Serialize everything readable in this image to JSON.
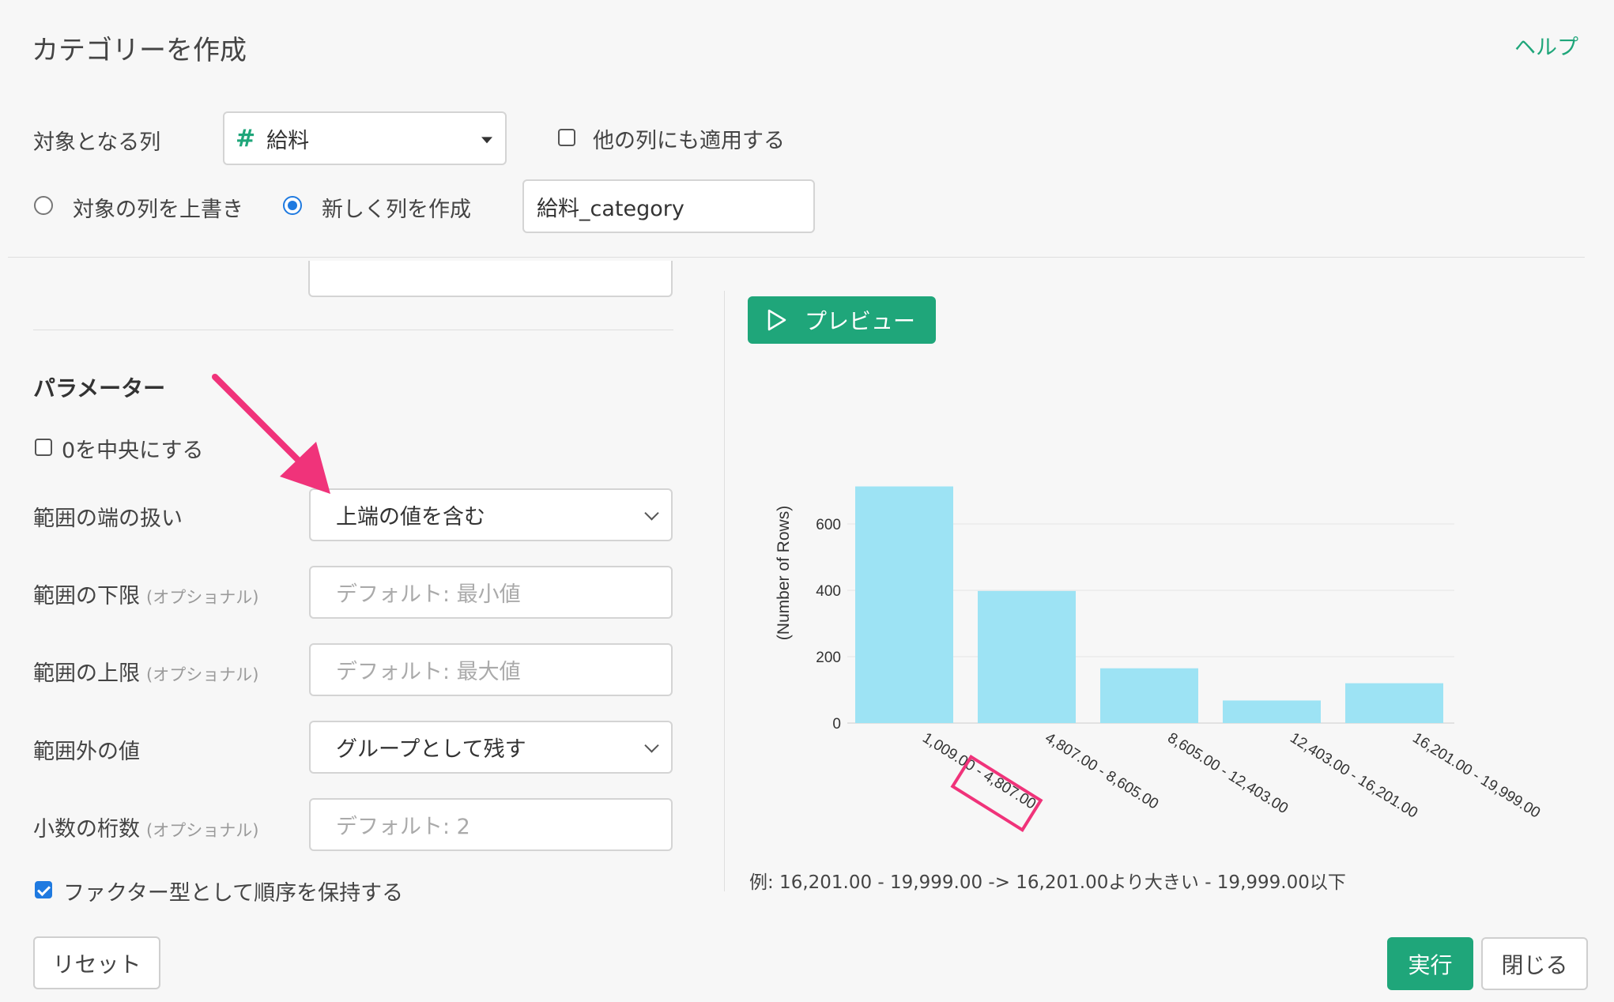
{
  "dialog": {
    "title": "カテゴリーを作成",
    "help": "ヘルプ"
  },
  "target": {
    "label": "対象となる列",
    "column_icon": "#",
    "column_value": "給料",
    "apply_other_label": "他の列にも適用する",
    "apply_other_checked": false,
    "overwrite_label": "対象の列を上書き",
    "new_column_label": "新しく列を作成",
    "new_column_selected": true,
    "new_column_name": "給料_category"
  },
  "params": {
    "heading": "パラメーター",
    "center_zero_label": "0を中央にする",
    "center_zero_checked": false,
    "range_edge_label": "範囲の端の扱い",
    "range_edge_value": "上端の値を含む",
    "lower_label": "範囲の下限",
    "lower_optional": "(オプショナル)",
    "lower_placeholder": "デフォルト: 最小値",
    "upper_label": "範囲の上限",
    "upper_optional": "(オプショナル)",
    "upper_placeholder": "デフォルト: 最大値",
    "outside_label": "範囲外の値",
    "outside_value": "グループとして残す",
    "decimals_label": "小数の桁数",
    "decimals_optional": "(オプショナル)",
    "decimals_placeholder": "デフォルト: 2",
    "factor_label": "ファクター型として順序を保持する",
    "factor_checked": true
  },
  "preview_button": "プレビュー",
  "example_text": "例: 16,201.00 - 19,999.00 -> 16,201.00より大きい - 19,999.00以下",
  "buttons": {
    "reset": "リセット",
    "run": "実行",
    "close": "閉じる"
  },
  "colors": {
    "accent_green": "#1fa67a",
    "bar": "#9de3f4",
    "annotation_pink": "#f0337a",
    "checkbox_blue": "#1f7ae0"
  },
  "chart_data": {
    "type": "bar",
    "categories": [
      "1,009.00 - 4,807.00",
      "4,807.00 - 8,605.00",
      "8,605.00 - 12,403.00",
      "12,403.00 - 16,201.00",
      "16,201.00 - 19,999.00"
    ],
    "values": [
      713,
      398,
      165,
      68,
      120
    ],
    "ylabel": "(Number of Rows)",
    "xlabel": "",
    "ylim": [
      0,
      720
    ],
    "yticks": [
      0,
      200,
      400,
      600
    ],
    "grid": true,
    "highlighted_label_part": "4,807.00"
  }
}
